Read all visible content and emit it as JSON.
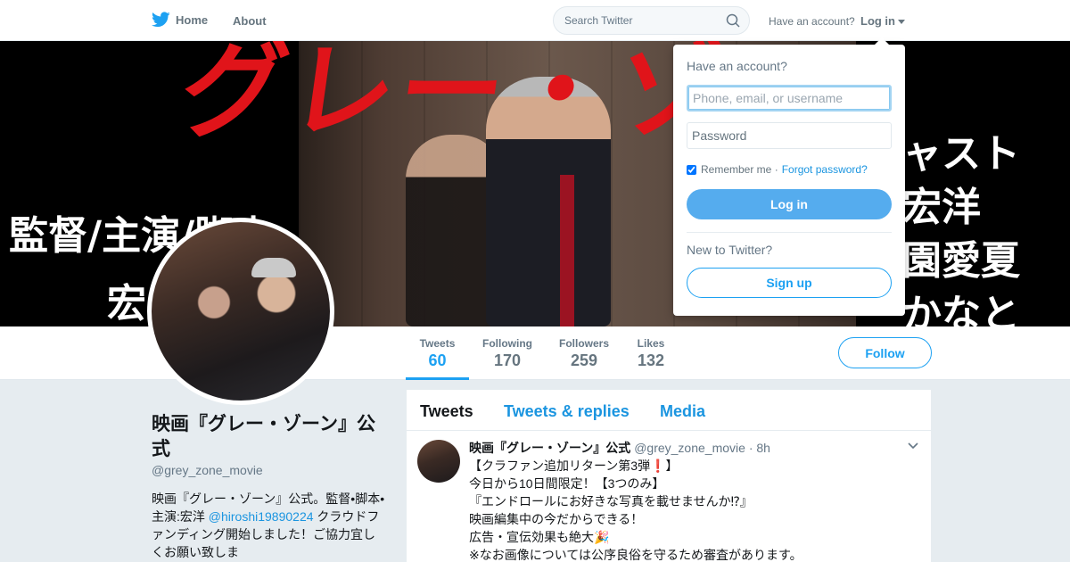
{
  "nav": {
    "home_label": "Home",
    "about_label": "About",
    "search_placeholder": "Search Twitter",
    "have_account": "Have an account?",
    "login_label": "Log in"
  },
  "banner": {
    "title_text": "グレー・ゾ",
    "left_line1": "監督/主演/脚本",
    "left_line2": "宏",
    "right_lines": [
      "ャスト",
      "宏洋",
      "園愛夏",
      "かなと"
    ]
  },
  "stats": [
    {
      "label": "Tweets",
      "value": "60",
      "active": true
    },
    {
      "label": "Following",
      "value": "170"
    },
    {
      "label": "Followers",
      "value": "259"
    },
    {
      "label": "Likes",
      "value": "132"
    }
  ],
  "follow_label": "Follow",
  "profile": {
    "name": "映画『グレー・ゾーン』公式",
    "handle": "@grey_zone_movie",
    "bio_part1": "映画『グレー・ゾーン』公式。監督•脚本•主演:宏洋 ",
    "bio_link": "@hiroshi19890224",
    "bio_part2": " クラウドファンディング開始しました！ご協力宜しくお願い致しま"
  },
  "timeline": {
    "tabs": [
      "Tweets",
      "Tweets & replies",
      "Media"
    ],
    "tweet": {
      "name": "映画『グレー・ゾーン』公式",
      "handle": "@grey_zone_movie",
      "time": "· 8h",
      "text": "【クラファン追加リターン第3弾❗】\n今日から10日間限定！【3つのみ】\n『エンドロールにお好きな写真を載せませんか⁉』\n映画編集中の今だからできる！\n広告・宣伝効果も絶大🎉\n※なお画像については公序良俗を守るため審査があります。"
    }
  },
  "login_dropdown": {
    "title": "Have an account?",
    "username_placeholder": "Phone, email, or username",
    "password_placeholder": "Password",
    "remember_label": "Remember me",
    "separator": "·",
    "forgot_label": "Forgot password?",
    "login_button": "Log in",
    "new_label": "New to Twitter?",
    "signup_button": "Sign up"
  },
  "colors": {
    "accent": "#1da1f2",
    "banner_title": "#e0141a",
    "background": "#e6ecf0"
  }
}
